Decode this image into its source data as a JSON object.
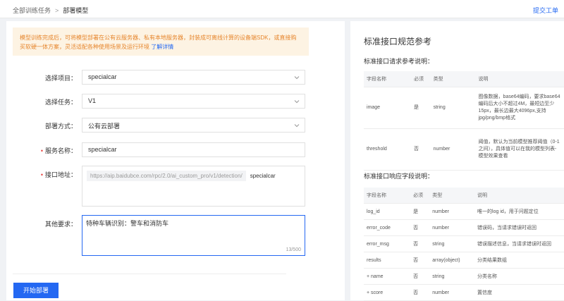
{
  "breadcrumb": {
    "parent": "全部训练任务",
    "current": "部署模型"
  },
  "header": {
    "submit_label": "提交工单"
  },
  "notice": {
    "text": "模型训练完成后，可将模型部署在公有云服务器、私有本地服务器，封装成可离线计算的设备端SDK，或直接购买软硬一体方案，灵活适配各种使用场景及运行环境",
    "link": "了解详情"
  },
  "form": {
    "project": {
      "label": "选择项目：",
      "value": "specialcar"
    },
    "task": {
      "label": "选择任务：",
      "value": "V1"
    },
    "deploy": {
      "label": "部署方式：",
      "value": "公有云部署"
    },
    "service": {
      "label": "服务名称：",
      "value": "specialcar"
    },
    "api": {
      "label": "接口地址：",
      "prefix": "https://aip.baidubce.com/rpc/2.0/ai_custom_pro/v1/detection/",
      "suffix": "specialcar"
    },
    "other": {
      "label": "其他要求：",
      "value": "特种车辆识别：警车和消防车",
      "counter": "13/500"
    },
    "start_button": "开始部署"
  },
  "reference": {
    "title": "标准接口规范参考",
    "request_title": "标准接口请求参考说明：",
    "response_title": "标准接口响应字段说明：",
    "headers": [
      "字段名称",
      "必须",
      "类型",
      "说明"
    ],
    "request_rows": [
      [
        "image",
        "是",
        "string",
        "图像数据，base64编码，要求base64编码后大小不超过4M，最短边至少15px，最长边最大4096px,支持jpg/png/bmp格式"
      ],
      [
        "threshold",
        "否",
        "number",
        "阈值，默认为当前模型推荐阈值（0-1之间），具体值可以在我的模型列表-模型效果查看"
      ]
    ],
    "response_rows": [
      [
        "log_id",
        "是",
        "number",
        "唯一的log id，用于问题定位"
      ],
      [
        "error_code",
        "否",
        "number",
        "错误码，当请求错误时返回"
      ],
      [
        "error_msg",
        "否",
        "string",
        "错误描述信息，当请求错误时返回"
      ],
      [
        "results",
        "否",
        "array(object)",
        "分类结果数组"
      ],
      [
        "+ name",
        "否",
        "string",
        "分类名称"
      ],
      [
        "+ score",
        "否",
        "number",
        "置信度"
      ]
    ]
  }
}
